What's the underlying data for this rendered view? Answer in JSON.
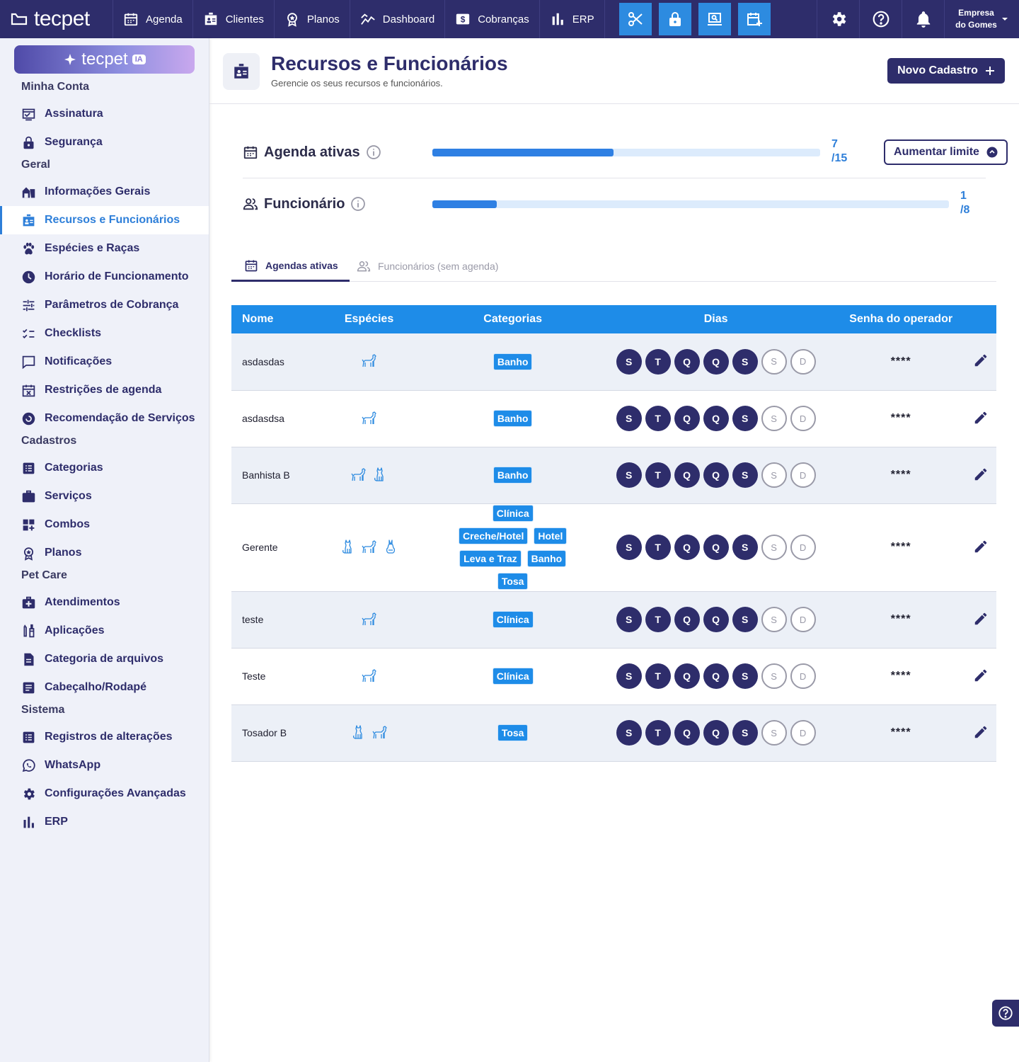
{
  "brand": {
    "logo_text": "tecpet",
    "ia_text": "tecpet",
    "ia_badge": "IA"
  },
  "topnav": [
    {
      "label": "Agenda",
      "icon": "calendar-icon"
    },
    {
      "label": "Clientes",
      "icon": "id-badge-icon"
    },
    {
      "label": "Planos",
      "icon": "award-icon"
    },
    {
      "label": "Dashboard",
      "icon": "chart-line-icon"
    },
    {
      "label": "Cobranças",
      "icon": "dollar-card-icon"
    },
    {
      "label": "ERP",
      "icon": "bar-chart-icon"
    }
  ],
  "quick_actions": [
    "scissors-icon",
    "lock-icon",
    "laptop-search-icon",
    "calendar-plus-icon"
  ],
  "tools": [
    "gear-icon",
    "help-circle-icon",
    "bell-icon"
  ],
  "company": {
    "line1": "Empresa",
    "line2": "do Gomes"
  },
  "sidebar": {
    "sections": [
      {
        "title": "Minha Conta",
        "items": [
          "Assinatura",
          "Segurança"
        ]
      },
      {
        "title": "Geral",
        "items": [
          "Informações Gerais",
          "Recursos e Funcionários",
          "Espécies e Raças",
          "Horário de Funcionamento",
          "Parâmetros de Cobrança",
          "Checklists",
          "Notificações",
          "Restrições de agenda",
          "Recomendação de Serviços"
        ]
      },
      {
        "title": "Cadastros",
        "items": [
          "Categorias",
          "Serviços",
          "Combos",
          "Planos"
        ]
      },
      {
        "title": "Pet Care",
        "items": [
          "Atendimentos",
          "Aplicações",
          "Categoria de arquivos",
          "Cabeçalho/Rodapé"
        ]
      },
      {
        "title": "Sistema",
        "items": [
          "Registros de alterações",
          "WhatsApp",
          "Configurações Avançadas",
          "ERP"
        ]
      }
    ],
    "active": "Recursos e Funcionários"
  },
  "page": {
    "title": "Recursos e Funcionários",
    "subtitle": "Gerencie os seus recursos e funcionários.",
    "new_button": "Novo Cadastro"
  },
  "limits": {
    "agenda": {
      "label": "Agenda ativas",
      "used": 7,
      "max": 15,
      "count_top": "7",
      "count_bottom": "/15"
    },
    "funcionario": {
      "label": "Funcionário",
      "used": 1,
      "max": 8,
      "count_top": "1",
      "count_bottom": "/8"
    },
    "raise_button": "Aumentar limite"
  },
  "tabs": [
    {
      "label": "Agendas ativas",
      "active": true
    },
    {
      "label": "Funcionários (sem agenda)",
      "active": false
    }
  ],
  "table": {
    "headers": {
      "name": "Nome",
      "species": "Espécies",
      "categories": "Categorias",
      "days": "Dias",
      "password": "Senha do operador"
    },
    "day_letters": [
      "S",
      "T",
      "Q",
      "Q",
      "S",
      "S",
      "D"
    ],
    "rows": [
      {
        "name": "asdasdas",
        "species": [
          "dog"
        ],
        "categories": [
          "Banho"
        ],
        "days_on": [
          true,
          true,
          true,
          true,
          true,
          false,
          false
        ],
        "password": "****"
      },
      {
        "name": "asdasdsa",
        "species": [
          "dog"
        ],
        "categories": [
          "Banho"
        ],
        "days_on": [
          true,
          true,
          true,
          true,
          true,
          false,
          false
        ],
        "password": "****"
      },
      {
        "name": "Banhista B",
        "species": [
          "dog",
          "cat"
        ],
        "categories": [
          "Banho"
        ],
        "days_on": [
          true,
          true,
          true,
          true,
          true,
          false,
          false
        ],
        "password": "****"
      },
      {
        "name": "Gerente",
        "species": [
          "cat",
          "dog",
          "rabbit"
        ],
        "categories": [
          "Clínica",
          "Creche/Hotel",
          "Hotel",
          "Leva e Traz",
          "Banho",
          "Tosa"
        ],
        "days_on": [
          true,
          true,
          true,
          true,
          true,
          false,
          false
        ],
        "password": "****"
      },
      {
        "name": "teste",
        "species": [
          "dog"
        ],
        "categories": [
          "Clínica"
        ],
        "days_on": [
          true,
          true,
          true,
          true,
          true,
          false,
          false
        ],
        "password": "****"
      },
      {
        "name": "Teste",
        "species": [
          "dog"
        ],
        "categories": [
          "Clínica"
        ],
        "days_on": [
          true,
          true,
          true,
          true,
          true,
          false,
          false
        ],
        "password": "****"
      },
      {
        "name": "Tosador B",
        "species": [
          "cat",
          "dog"
        ],
        "categories": [
          "Tosa"
        ],
        "days_on": [
          true,
          true,
          true,
          true,
          true,
          false,
          false
        ],
        "password": "****"
      }
    ]
  },
  "colors": {
    "primary": "#2e2d6b",
    "accent": "#1e8ce8",
    "link": "#2e7fd9"
  }
}
